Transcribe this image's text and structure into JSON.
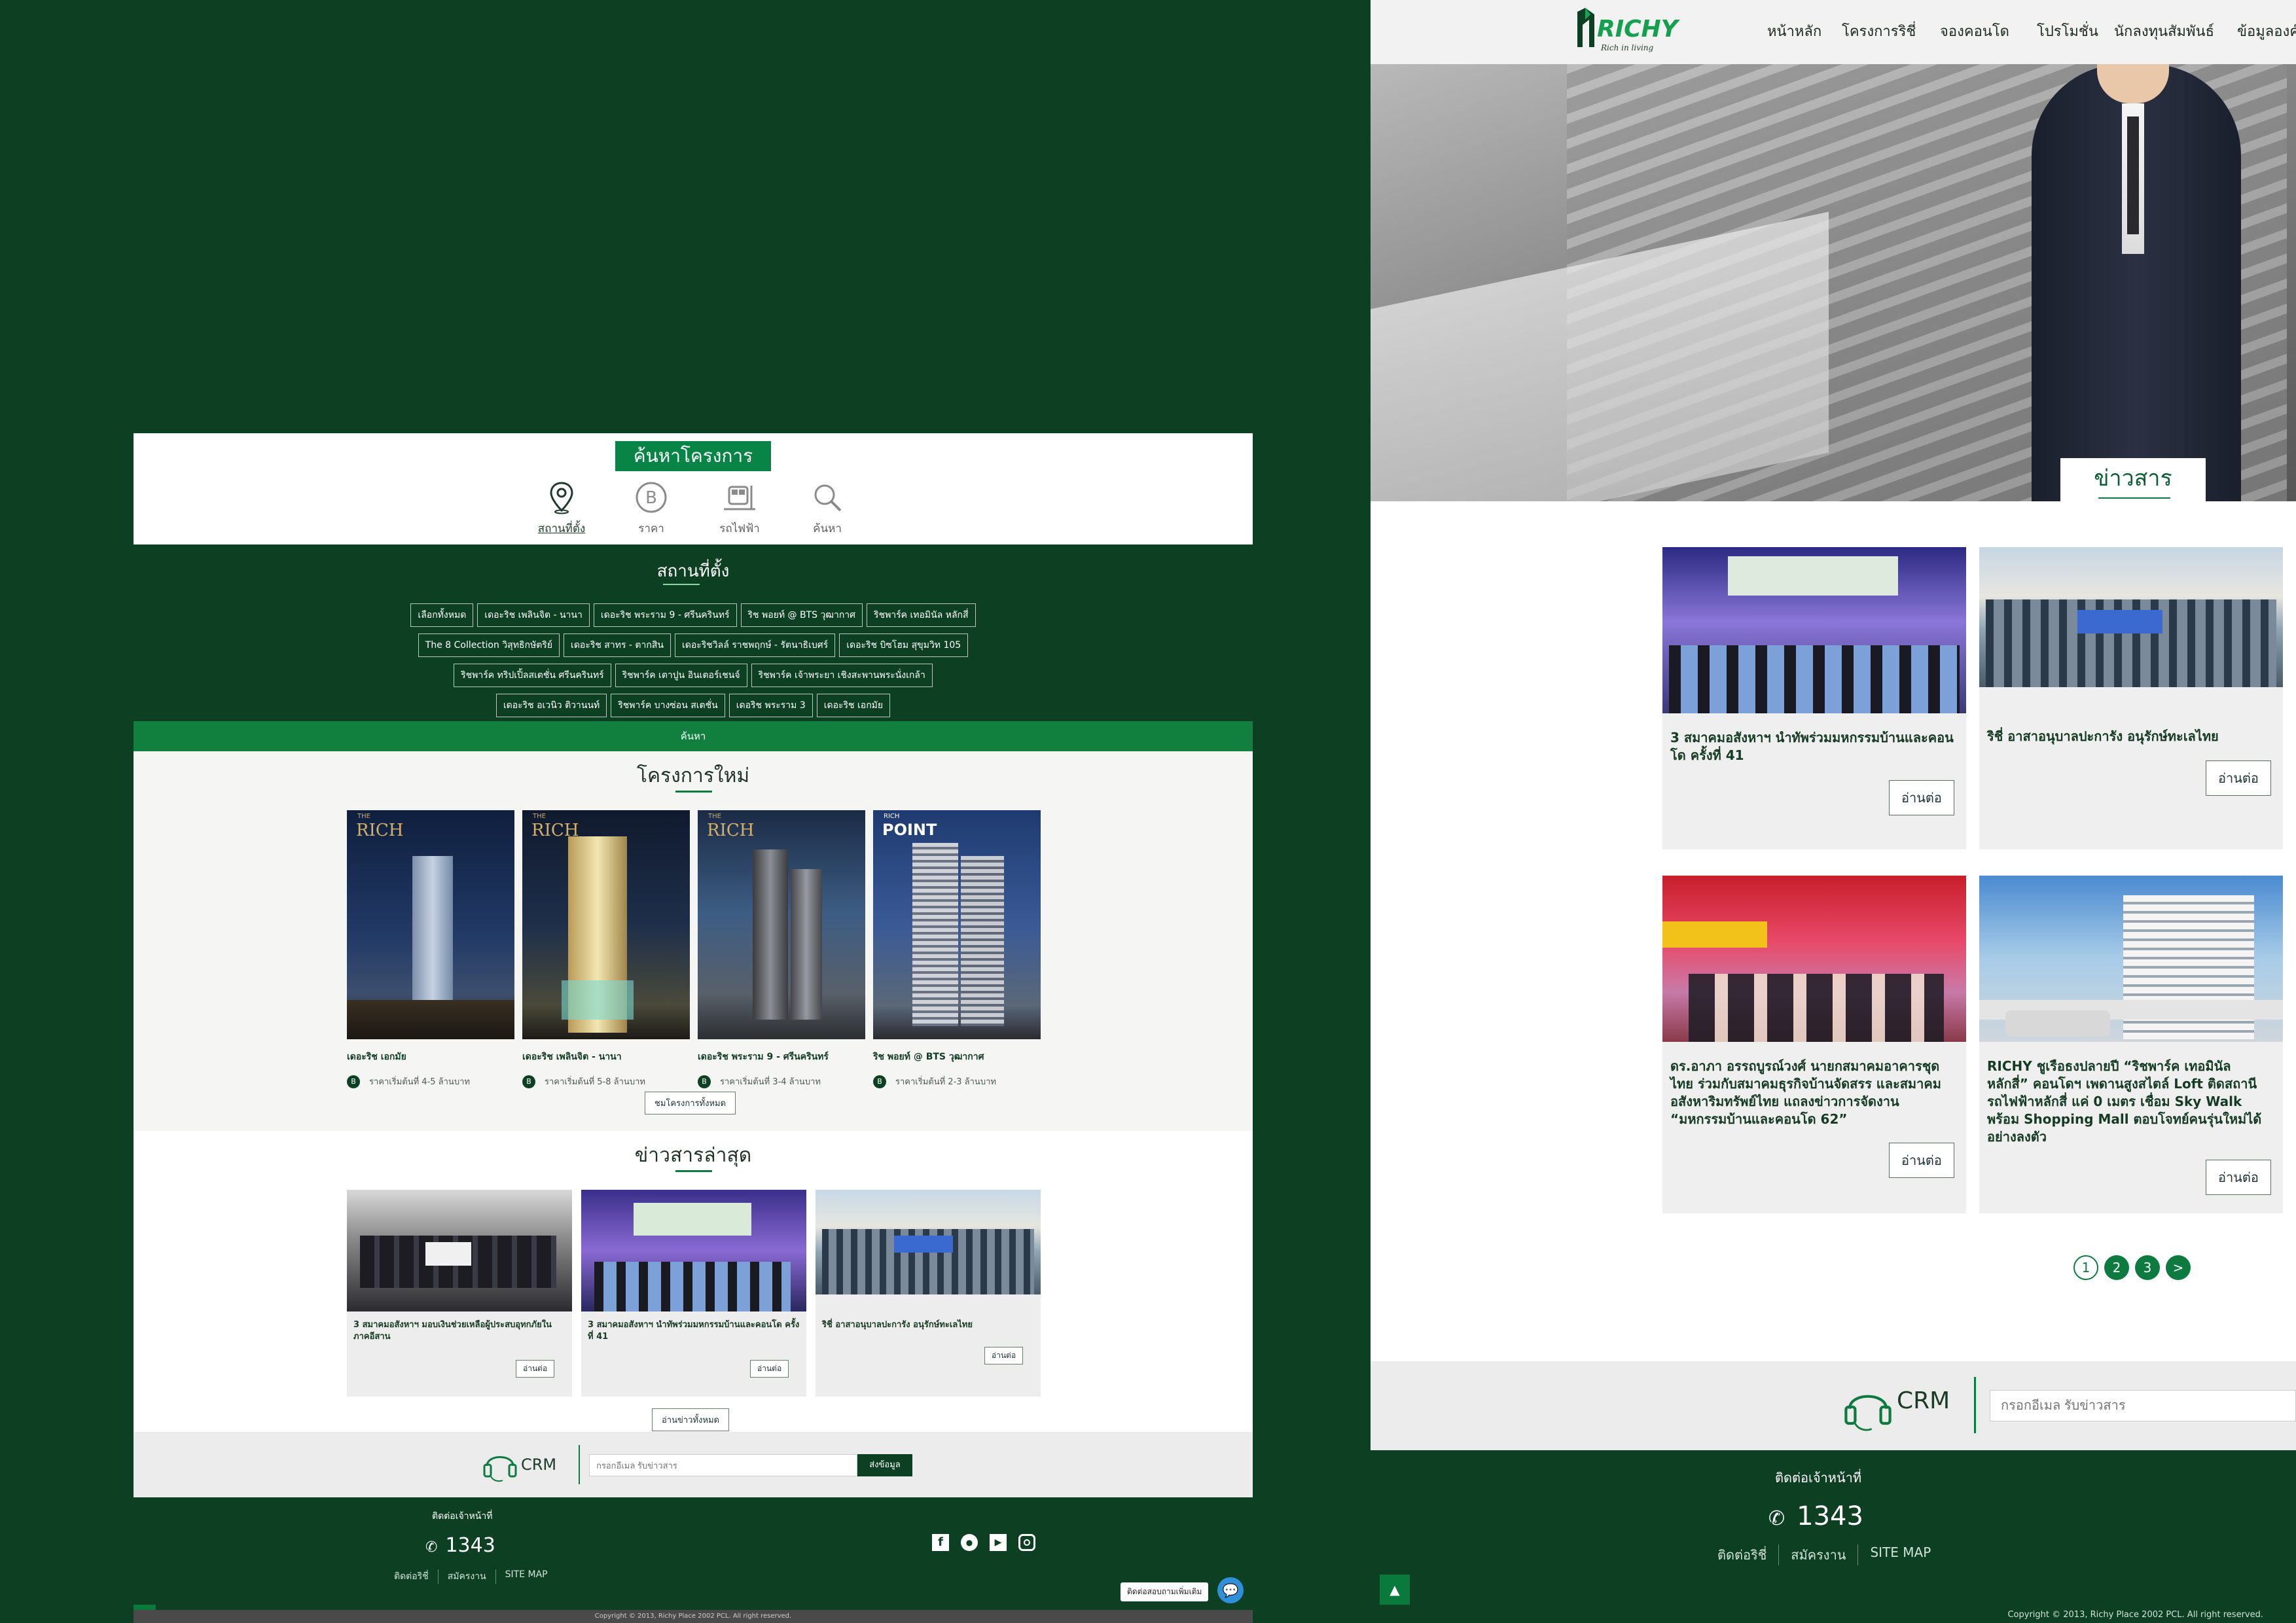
{
  "left": {
    "search_title": "ค้นหาโครงการ",
    "search_tabs": [
      {
        "label": "สถานที่ตั้ง",
        "icon": "location-pin-icon"
      },
      {
        "label": "ราคา",
        "icon": "baht-icon"
      },
      {
        "label": "รถไฟฟ้า",
        "icon": "train-icon"
      },
      {
        "label": "ค้นหา",
        "icon": "search-icon"
      }
    ],
    "location_title": "สถานที่ตั้ง",
    "location_rows": [
      [
        "เลือกทั้งหมด",
        "เดอะริช เพลินจิต - นานา",
        "เดอะริช พระราม 9 - ศรีนครินทร์",
        "ริช พอยท์ @ BTS วุฒากาศ",
        "ริชพาร์ค เทอมินัล หลักสี่"
      ],
      [
        "The 8 Collection วิสุทธิกษัตริย์",
        "เดอะริช สาทร - ตากสิน",
        "เดอะริชวิลล์ ราชพฤกษ์ - รัตนาธิเบศร์",
        "เดอะริช บิซโฮม สุขุมวิท 105"
      ],
      [
        "ริชพาร์ค ทริปเปิ้ลสเตชั่น ศรีนครินทร์",
        "ริชพาร์ค เตาปูน อินเตอร์เชนจ์",
        "ริชพาร์ค เจ้าพระยา เชิงสะพานพระนั่งเกล้า"
      ],
      [
        "เดอะริช อเวนิว ติวานนท์",
        "ริชพาร์ค บางซ่อน สเตชั่น",
        "เดอริช พระราม 3",
        "เดอะริช เอกมัย"
      ]
    ],
    "search_button": "ค้นหา",
    "projects_title": "โครงการใหม่",
    "projects": [
      {
        "name": "เดอะริช เอกมัย",
        "price": "ราคาเริ่มต้นที่ 4-5 ล้านบาท",
        "logo": "RICH",
        "logo_small": "THE"
      },
      {
        "name": "เดอะริช เพลินจิต - นานา",
        "price": "ราคาเริ่มต้นที่ 5-8 ล้านบาท",
        "logo": "RICH",
        "logo_small": "THE"
      },
      {
        "name": "เดอะริช พระราม 9 - ศรีนครินทร์",
        "price": "ราคาเริ่มต้นที่ 3-4 ล้านบาท",
        "logo": "RICH",
        "logo_small": "THE"
      },
      {
        "name": "ริช พอยท์ @ BTS วุฒากาศ",
        "price": "ราคาเริ่มต้นที่ 2-3 ล้านบาท",
        "logo": "POINT",
        "logo_small": "RICH"
      }
    ],
    "price_badge": "B",
    "projects_more": "ชมโครงการทั้งหมด",
    "news_title": "ข่าวสารล่าสุด",
    "news": [
      {
        "title": "3 สมาคมอสังหาฯ มอบเงินช่วยเหลือผู้ประสบอุทกภัยในภาคอีสาน",
        "button": "อ่านต่อ"
      },
      {
        "title": "3 สมาคมอสังหาฯ นำทัพร่วมมหกรรมบ้านและคอนโด ครั้งที่ 41",
        "button": "อ่านต่อ"
      },
      {
        "title": "ริชี่ อาสาอนุบาลปะการัง อนุรักษ์ทะเลไทย",
        "button": "อ่านต่อ"
      }
    ],
    "news_more": "อ่านข่าวทั้งหมด",
    "crm_label": "CRM",
    "crm_placeholder": "กรอกอีเมล รับข่าวสาร",
    "crm_button": "ส่งข้อมูล",
    "footer_contact": "ติดต่อเจ้าหน้าที่",
    "footer_phone": "1343",
    "footer_links": [
      "ติดต่อริชี่",
      "สมัครงาน",
      "SITE MAP"
    ],
    "chat_label": "ติดต่อสอบถามเพิ่มเติม",
    "copyright": "Copyright © 2013, Richy Place 2002 PCL. All right reserved."
  },
  "right": {
    "logo": "RICHY",
    "logo_tagline": "Rich in living",
    "nav": [
      "หน้าหลัก",
      "โครงการริชี่",
      "จองคอนโด",
      "โปรโมชั่น",
      "นักลงทุนสัมพันธ์",
      "ข้อมูลองค์"
    ],
    "news_tab": "ข่าวสาร",
    "news": [
      {
        "title": "3 สมาคมอสังหาฯ นำทัพร่วมมหกรรมบ้านและคอนโด ครั้งที่ 41",
        "button": "อ่านต่อ"
      },
      {
        "title": "ริชี่ อาสาอนุบาลปะการัง อนุรักษ์ทะเลไทย",
        "button": "อ่านต่อ"
      },
      {
        "title": "ดร.อาภา อรรถบูรณ์วงศ์ นายกสมาคมอาคารชุดไทย ร่วมกับสมาคมธุรกิจบ้านจัดสรร และสมาคมอสังหาริมทรัพย์ไทย แถลงข่าวการจัดงาน “มหกรรมบ้านและคอนโด 62”",
        "button": "อ่านต่อ"
      },
      {
        "title": "RICHY ชูเรือธงปลายปี “ริชพาร์ค เทอมินัล หลักสี่” คอนโดฯ เพดานสูงสไตล์ Loft ติดสถานีรถไฟฟ้าหลักสี่ แค่ 0 เมตร เชื่อม Sky Walk พร้อม Shopping Mall ตอบโจทย์คนรุ่นใหม่ได้อย่างลงตัว",
        "button": "อ่านต่อ"
      }
    ],
    "pagination": [
      "1",
      "2",
      "3",
      ">"
    ],
    "crm_label": "CRM",
    "crm_placeholder": "กรอกอีเมล รับข่าวสาร",
    "footer_contact": "ติดต่อเจ้าหน้าที่",
    "footer_phone": "1343",
    "footer_links": [
      "ติดต่อริชี่",
      "สมัครงาน",
      "SITE MAP"
    ],
    "copyright": "Copyright © 2013, Richy Place 2002 PCL. All right reserved."
  },
  "colors": {
    "brand_dark": "#0d3f22",
    "brand_green": "#078446",
    "light_bg": "#f5f6f4"
  }
}
